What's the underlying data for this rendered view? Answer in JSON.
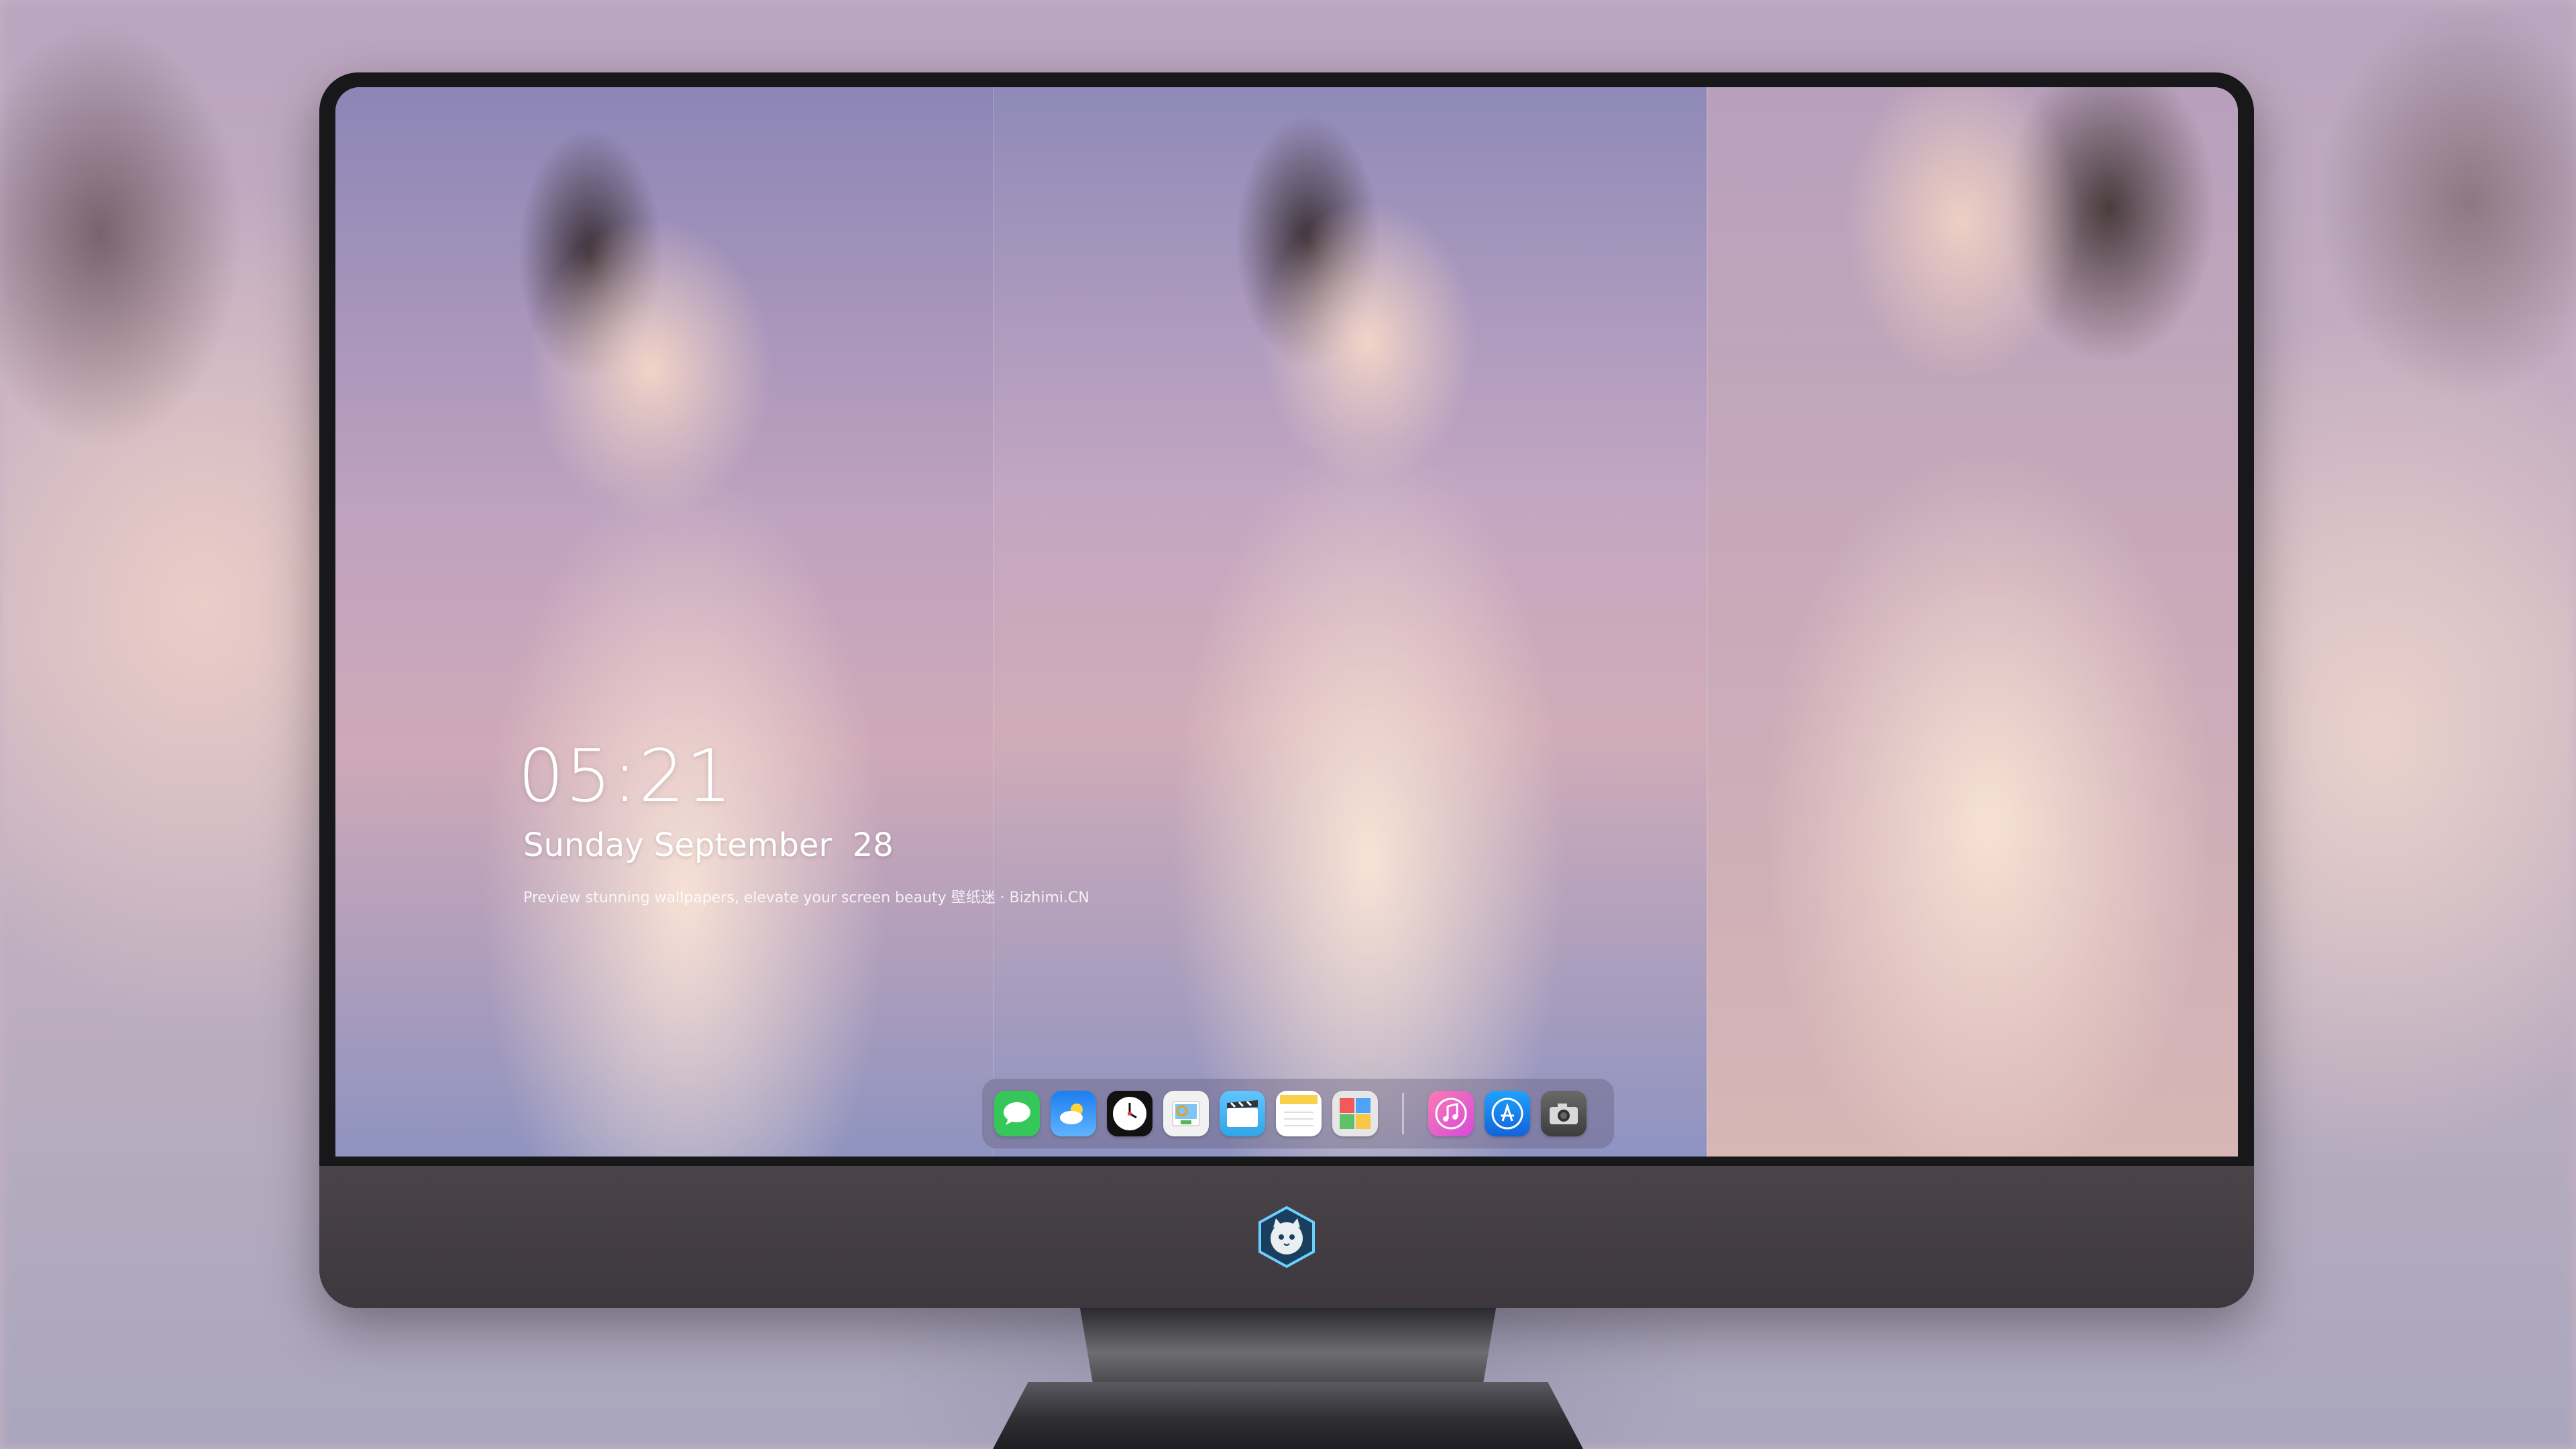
{
  "lock_screen": {
    "time": "05:21",
    "date": "Sunday September  28",
    "caption": "Preview stunning wallpapers, elevate your screen beauty  壁纸迷 · Bizhimi.CN"
  },
  "dock": {
    "apps": [
      {
        "name": "messages-icon",
        "color": "#35c759"
      },
      {
        "name": "weather-icon",
        "color": "#1f8fff"
      },
      {
        "name": "clock-icon",
        "color": "#111111"
      },
      {
        "name": "preview-icon",
        "color": "#f1f1f1"
      },
      {
        "name": "clips-icon",
        "color": "#4fb7f5"
      },
      {
        "name": "notes-icon",
        "color": "#f7d14a"
      },
      {
        "name": "photo-booth-icon",
        "color": "#e8e8e8"
      },
      {
        "name": "music-icon",
        "color": "#f25d98"
      },
      {
        "name": "app-store-icon",
        "color": "#1b8cff"
      },
      {
        "name": "camera-icon",
        "color": "#555555"
      }
    ]
  },
  "colors": {
    "bezel": "#18171a",
    "chin": "#443f44",
    "dock_bg": "rgba(90,80,110,0.32)"
  },
  "chin_logo": {
    "name": "cat-mascot-logo-icon"
  }
}
